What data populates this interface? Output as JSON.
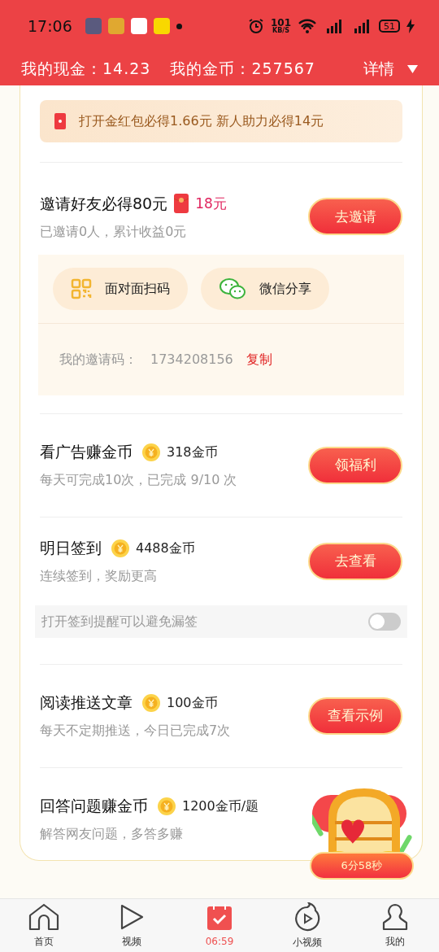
{
  "status_bar": {
    "time": "17:06",
    "speed": "101",
    "speed_unit": "KB/S",
    "battery": "51"
  },
  "header": {
    "cash": "我的现金：14.23",
    "coins": "我的金币：257567",
    "details": "详情"
  },
  "banner": {
    "text": "打开金红包必得1.66元 新人助力必得14元"
  },
  "invite": {
    "title": "邀请好友必得80元",
    "reward": "18元",
    "subtitle": "已邀请0人，累计收益0元",
    "button": "去邀请",
    "share_buttons": [
      {
        "kind": "qr",
        "label": "面对面扫码"
      },
      {
        "kind": "wechat",
        "label": "微信分享"
      }
    ],
    "code_label": "我的邀请码：",
    "code": "1734208156",
    "copy": "复制"
  },
  "tasks": [
    {
      "title": "看广告赚金币",
      "reward": "318金币",
      "subtitle": "每天可完成10次，已完成 9/10 次",
      "button": "领福利"
    },
    {
      "title": "明日签到",
      "reward": "4488金币",
      "subtitle": "连续签到，奖励更高",
      "button": "去查看",
      "reminder": {
        "text": "打开签到提醒可以避免漏签",
        "on": false
      }
    },
    {
      "title": "阅读推送文章",
      "reward": "100金币",
      "subtitle": "每天不定期推送，今日已完成7次",
      "button": "查看示例"
    },
    {
      "title": "回答问题赚金币",
      "reward": "1200金币/题",
      "subtitle": "解答网友问题，多答多赚"
    }
  ],
  "chest": {
    "timer": "6分58秒"
  },
  "bottom_nav": [
    {
      "kind": "home",
      "label": "首页",
      "selected": false
    },
    {
      "kind": "play",
      "label": "视频",
      "selected": false
    },
    {
      "kind": "calendar",
      "label": "06:59",
      "selected": true
    },
    {
      "kind": "flame",
      "label": "小视频",
      "selected": false
    },
    {
      "kind": "person",
      "label": "我的",
      "selected": false
    }
  ]
}
